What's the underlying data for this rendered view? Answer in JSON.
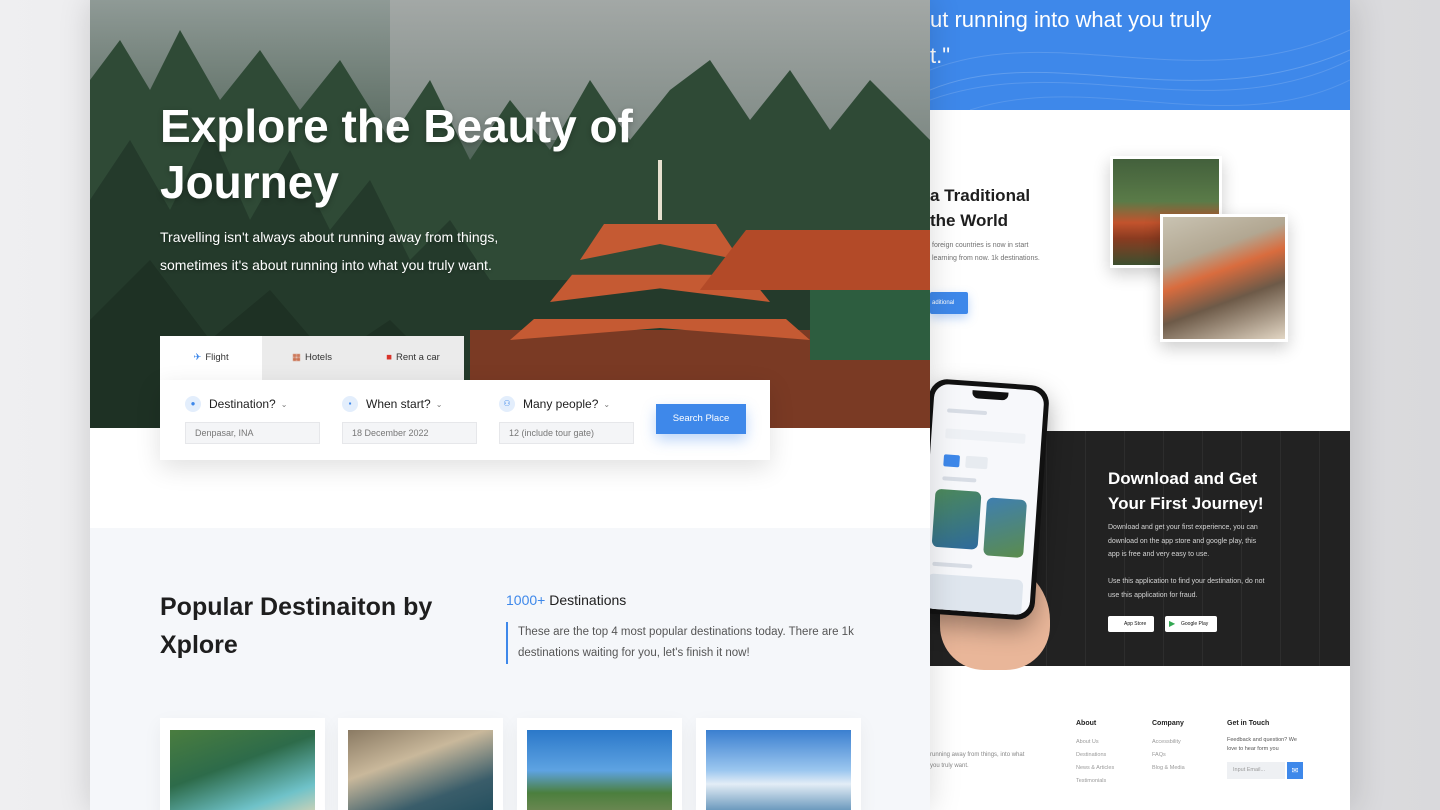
{
  "hero": {
    "title": "Explore the Beauty of Journey",
    "subtitle": "Travelling isn't always about running away from things, sometimes it's about running into what you truly want."
  },
  "booking": {
    "tabs": [
      {
        "label": "Flight",
        "icon": "airplane-icon",
        "active": true
      },
      {
        "label": "Hotels",
        "icon": "hotel-icon",
        "active": false
      },
      {
        "label": "Rent a car",
        "icon": "car-icon",
        "active": false
      }
    ],
    "fields": [
      {
        "label": "Destination?",
        "icon": "location-pin-icon",
        "value": "Denpasar, INA"
      },
      {
        "label": "When start?",
        "icon": "calendar-icon",
        "value": "18 December 2022"
      },
      {
        "label": "Many people?",
        "icon": "people-icon",
        "value": "12 (include tour gate)"
      }
    ],
    "search_label": "Search Place"
  },
  "popular": {
    "title": "Popular Destinaiton by Xplore",
    "count_highlight": "1000+",
    "count_label": "Destinations",
    "description": "These are the top 4 most popular destinations today. There are 1k destinations waiting for you, let's finish it now!"
  },
  "right": {
    "quote_line1": "ut running into what you truly",
    "quote_line2": "t.\"",
    "traditional_title": "a Traditional the World",
    "traditional_desc": "foreign countries is now in start learning from now. 1k destinations.",
    "traditional_btn": "aditional",
    "download": {
      "title": "Download and Get Your First Journey!",
      "p1": "Download and get your first experience, you can download on the app store and google play, this app is free and very easy to use.",
      "p2": "Use this application to find your destination, do not use this application for fraud.",
      "app_store": "App Store",
      "google_play": "Google Play"
    },
    "footer": {
      "text": "running away from things, into what you truly want.",
      "about": {
        "title": "About",
        "items": [
          "About Us",
          "Destinations",
          "News & Articles",
          "Testimonials"
        ]
      },
      "company": {
        "title": "Company",
        "items": [
          "Accessbility",
          "FAQs",
          "Blog & Media"
        ]
      },
      "contact": {
        "title": "Get in Touch",
        "text": "Feedback and question? We love to hear form you",
        "email_placeholder": "Input Email..."
      }
    }
  },
  "colors": {
    "accent": "#3e88ea",
    "dark": "#222222",
    "text": "#1e1e1e"
  }
}
